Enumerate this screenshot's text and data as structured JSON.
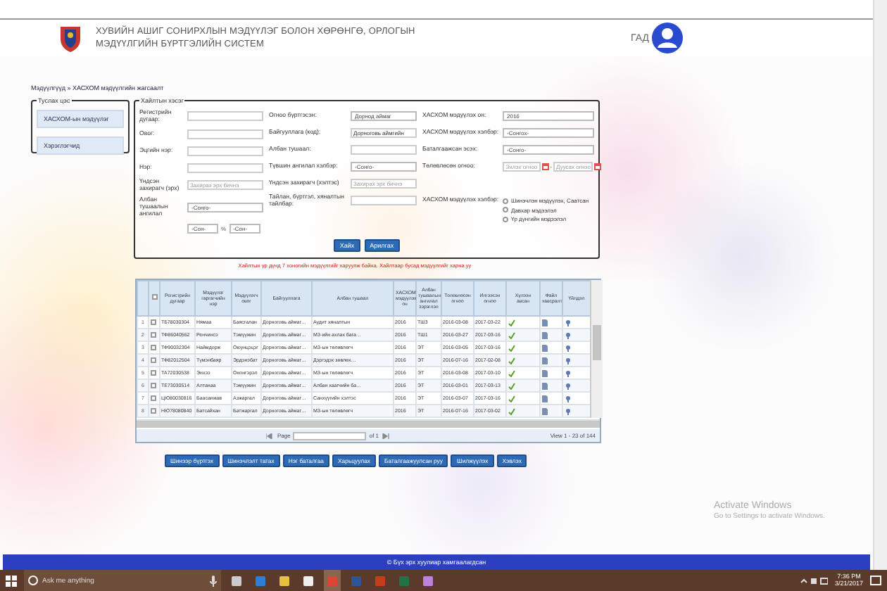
{
  "header": {
    "title_lines": [
      "ХУВИЙН АШИГ СОНИРХЛЫН МЭДҮҮЛЭГ БОЛОН ХӨРӨНГӨ, ОРЛОГЫН",
      "МЭДҮҮЛГИЙН БҮРТГЭЛИЙН СИСТЕМ"
    ],
    "user": "ГАД"
  },
  "breadcrumb": "Мэдүүлгүүд » ХАСХОМ мэдүүлгийн жагсаалт",
  "sidebar": {
    "legend": "Туслах цэс",
    "items": [
      {
        "label": "ХАСХОМ-ын мэдүүлэг"
      },
      {
        "label": "Хэрэглэгчид"
      }
    ]
  },
  "search": {
    "legend": "Хайлтын хэсэг",
    "columns": [
      [
        {
          "kind": "text",
          "label": "Регистрийн дугаар:"
        },
        {
          "kind": "text",
          "label": "Овог:"
        },
        {
          "kind": "text",
          "label": "Эцгийн нэр:"
        },
        {
          "kind": "text",
          "label": "Нэр:"
        },
        {
          "kind": "text",
          "label": "Үндсэн захирагч (эрх)",
          "placeholder": "Захирах эрх бичнэ"
        },
        {
          "kind": "select",
          "label": "Албан тушаалын ангилал",
          "value": "-Сонго-"
        },
        {
          "kind": "pair",
          "first": "-Сон-",
          "sep": "%",
          "second": "-Сон-"
        }
      ],
      [
        {
          "kind": "select",
          "label": "Огноо бүртгэсэн:",
          "value": "Дорнод аймаг"
        },
        {
          "kind": "text",
          "label": "Байгууллага (код):",
          "value": "Дорноговь аймгийн"
        },
        {
          "kind": "text",
          "label": "Албан тушаал:"
        },
        {
          "kind": "select",
          "label": "Түвшин ангилал хэлбэр:",
          "value": "-Сонго-"
        },
        {
          "kind": "text",
          "label": "Үндсэн захирагч (хэлтэс)",
          "placeholder": "Захирах эрх бичнэ"
        },
        {
          "kind": "text",
          "label": "Тайлан, бүртгэл, хяналтын тайлбар:"
        }
      ],
      [
        {
          "kind": "select",
          "label": "ХАСХОМ мэдүүлэх он:",
          "value": "2016"
        },
        {
          "kind": "select",
          "label": "ХАСХОМ мэдүүлэх хэлбэр:",
          "value": "-Сонгох-"
        },
        {
          "kind": "select",
          "label": "Баталгаажсан эсэх:",
          "value": "-Сонго-"
        },
        {
          "kind": "dates",
          "label": "Төлөвлөсөн огноо:",
          "from": "Эхлэх огноо",
          "sep": "-",
          "to": "Дуусах огноо"
        },
        {
          "kind": "radios",
          "label": "ХАСХОМ мэдүүлэх хэлбэр:",
          "options": [
            {
              "label": "Шинэчлэн мэдүүлэх, Саатсан",
              "selected": false
            },
            {
              "label": "Давхар мэдээлэл",
              "selected": false
            },
            {
              "label": "Үр дүнгийн мэдээлэл",
              "selected": false
            }
          ]
        }
      ]
    ],
    "buttons": [
      "Хайх",
      "Арилгах"
    ]
  },
  "note": "Хайлтын үр дүнд 7 хоногийн мэдүүлгийг харуулж байна. Хайлтаар бусад мэдүүлгийг харна уу",
  "table": {
    "select_all_checked": false,
    "columns": [
      "Регистрийн дугаар",
      "Мэдүүлэг гаргагчийн нэр",
      "Мэдүүлэгч овог",
      "Байгууллага",
      "Албан тушаал",
      "ХАСХОМ мэдүүлэх он",
      "Албан тушаалын ангилал зэрэглэл",
      "Төлөвлөсөн огноо",
      "Илгээсэн огноо",
      "Хүлээн авсан",
      "Файл хавсралт",
      "Үйлдэл"
    ],
    "rows": [
      {
        "n": "1",
        "checked": false,
        "cells": [
          "ТБ78030304",
          "Нямаа",
          "Баясгалан",
          "Дорноговь аймаг…",
          "Аудит хяналтын",
          "2016",
          "ТШ3",
          "2016-03-08",
          "2017-03-22"
        ],
        "accepted": true
      },
      {
        "n": "2",
        "checked": false,
        "cells": [
          "ТФ86040562",
          "Ренчинсэ",
          "Тэмүүжин",
          "Дорноговь аймаг…",
          "МЗ-ийн ахлах бага…",
          "2016",
          "ТШ1",
          "2016-03-27",
          "2017-03-16"
        ],
        "accepted": true
      },
      {
        "n": "3",
        "checked": false,
        "cells": [
          "ТФ90032304",
          "Наймдорж",
          "Оюунцэцэг",
          "Дорноговь аймаг…",
          "МЗ-ын төлөвлөгч",
          "2016",
          "ЭТ",
          "2016-03-05",
          "2017-03-16"
        ],
        "accepted": true
      },
      {
        "n": "4",
        "checked": false,
        "cells": [
          "ТФ82012504",
          "Түмэнбаяр",
          "Эрдэнэбат",
          "Дорноговь аймаг…",
          "Дэргэдэх зөвлөх…",
          "2016",
          "ЭТ",
          "2016-07-16",
          "2017-02-08"
        ],
        "accepted": true
      },
      {
        "n": "5",
        "checked": false,
        "cells": [
          "ТА72030538",
          "Энхээ",
          "Ононгэрэл",
          "Дорноговь аймаг…",
          "МЗ-ын төлөвлөгч",
          "2016",
          "ЭТ",
          "2016-03-08",
          "2017-03-10"
        ],
        "accepted": true
      },
      {
        "n": "6",
        "checked": false,
        "cells": [
          "ТЕ73030514",
          "Алтанаа",
          "Тэмүүжин",
          "Дорноговь аймаг…",
          "Албан хаагчийн ба…",
          "2016",
          "ЭТ",
          "2016-03-01",
          "2017-03-13"
        ],
        "accepted": true
      },
      {
        "n": "7",
        "checked": false,
        "cells": [
          "ЦЮ80030816",
          "Баасанжав",
          "Азжаргал",
          "Дорноговь аймаг…",
          "Санхүүгийн хэлтэс",
          "2016",
          "ЭТ",
          "2016-03-07",
          "2017-03-16"
        ],
        "accepted": true
      },
      {
        "n": "8",
        "checked": false,
        "cells": [
          "НЮ78080840",
          "Батсайхан",
          "Батжаргал",
          "Дорноговь аймаг…",
          "МЗ-ын төлөвлөгч",
          "2016",
          "ЭТ",
          "2016-07-16",
          "2017-03-02"
        ],
        "accepted": true
      }
    ],
    "pager": {
      "page_label": "Page",
      "of": "of 1",
      "view": "View 1 - 23 of 144"
    }
  },
  "actions": [
    "Шинээр бүртгэх",
    "Шинэчлэлт татах",
    "Нэг баталгаа",
    "Харьцуулах",
    "Баталгаажуулсан руу",
    "Шилжүүлэх",
    "Хэвлэх"
  ],
  "activation": [
    "Activate Windows",
    "Go to Settings to activate Windows."
  ],
  "footer": "© Бүх эрх хуулиар хамгаалагдсан",
  "taskbar": {
    "search_placeholder": "Ask me anything",
    "time": "7:36 PM",
    "date": "3/21/2017"
  }
}
